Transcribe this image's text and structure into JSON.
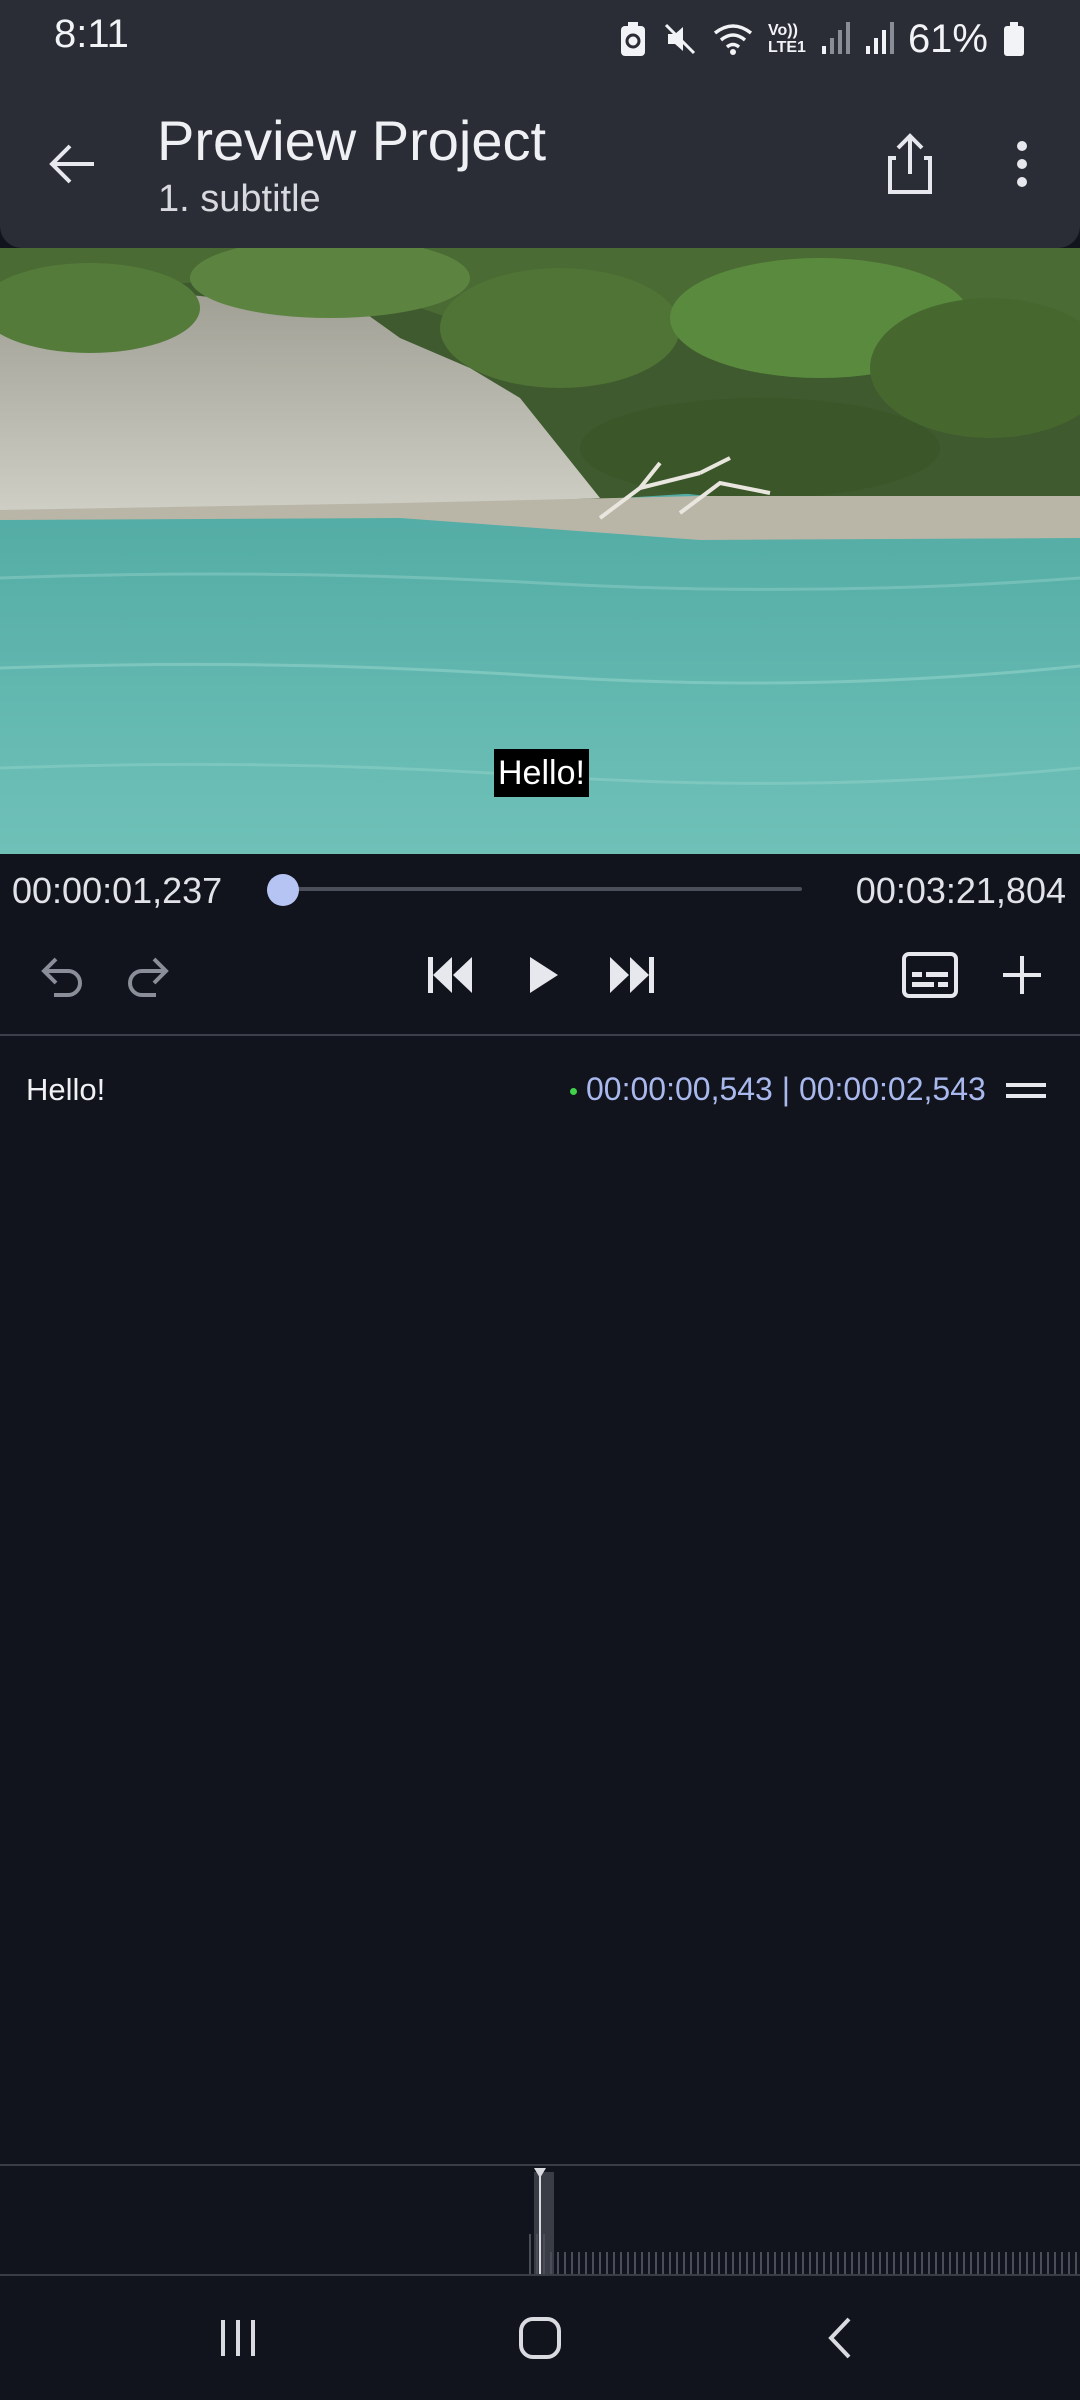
{
  "status_bar": {
    "time": "8:11",
    "battery": "61%",
    "icons": [
      "data-saver-icon",
      "mute-icon",
      "wifi-icon",
      "volte-lte-icon",
      "signal-icon",
      "signal-icon",
      "battery-icon"
    ],
    "volte_label_top": "Vo))",
    "volte_label_bottom": "LTE1"
  },
  "app_bar": {
    "title": "Preview Project",
    "subtitle": "1. subtitle",
    "icons": [
      "back-arrow-icon",
      "share-icon",
      "more-vert-icon"
    ]
  },
  "video": {
    "caption": "Hello!"
  },
  "seek": {
    "current": "00:00:01,237",
    "total": "00:03:21,804",
    "progress": 0.006
  },
  "controls": {
    "icons": [
      "undo-icon",
      "redo-icon",
      "skip-previous-icon",
      "play-icon",
      "skip-next-icon",
      "subtitles-icon",
      "add-icon"
    ]
  },
  "subtitles": [
    {
      "text": "Hello!",
      "times": "00:00:00,543 | 00:00:02,543",
      "status_color": "#41d14b"
    }
  ],
  "nav_bar": {
    "icons": [
      "recents-icon",
      "home-icon",
      "back-icon"
    ]
  },
  "colors": {
    "accent": "#b5c4f2",
    "timecode": "#a9b9ee",
    "background": "#11141c",
    "appbar": "#2a2d35"
  }
}
